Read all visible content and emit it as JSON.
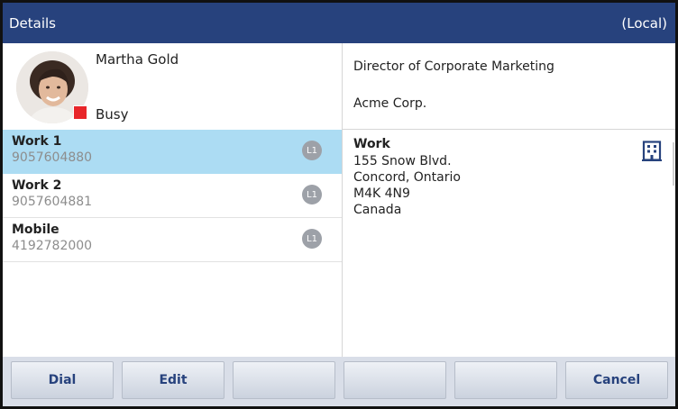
{
  "titlebar": {
    "title": "Details",
    "location": "(Local)"
  },
  "contact": {
    "name": "Martha Gold",
    "presence": "Busy",
    "presence_color": "#e8262a"
  },
  "numbers": [
    {
      "label": "Work 1",
      "value": "9057604880",
      "line": "L1",
      "selected": true
    },
    {
      "label": "Work 2",
      "value": "9057604881",
      "line": "L1",
      "selected": false
    },
    {
      "label": "Mobile",
      "value": "4192782000",
      "line": "L1",
      "selected": false
    }
  ],
  "details": {
    "job_title": "Director of Corporate Marketing",
    "company": "Acme Corp."
  },
  "address": {
    "label": "Work",
    "lines": [
      "155 Snow Blvd.",
      "Concord, Ontario",
      "M4K 4N9",
      "Canada"
    ],
    "icon": "building-icon"
  },
  "softkeys": [
    "Dial",
    "Edit",
    "",
    "",
    "",
    "Cancel"
  ],
  "colors": {
    "titlebar": "#27427d",
    "selected_row": "#acdcf3",
    "softkey_text": "#27427d"
  }
}
